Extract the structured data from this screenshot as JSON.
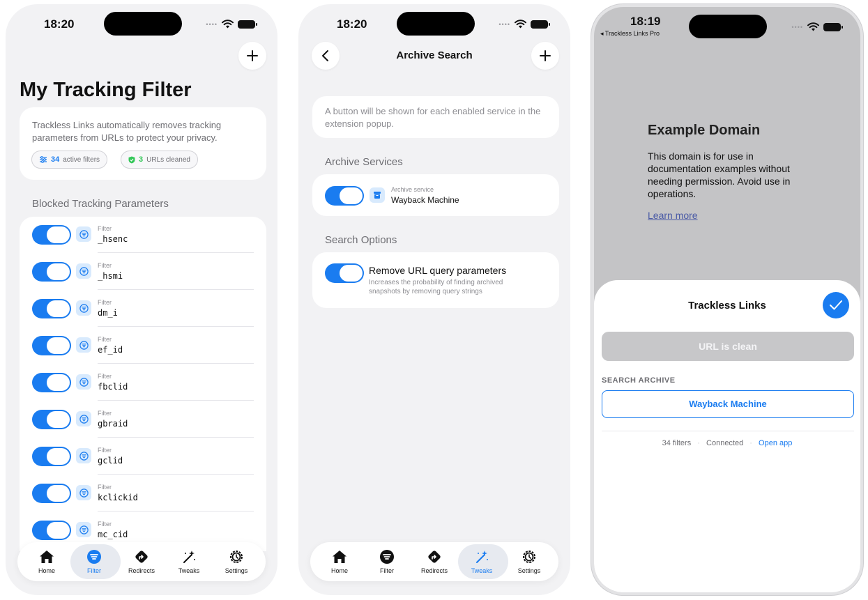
{
  "colors": {
    "accent": "#1a7cf0",
    "success": "#34c759"
  },
  "phone1": {
    "time": "18:20",
    "page_title": "My Tracking Filter",
    "intro": "Trackless Links automatically removes tracking parameters from URLs to protect your privacy.",
    "chips": [
      {
        "value": "34",
        "label": "active filters",
        "icon": "sliders-icon"
      },
      {
        "value": "3",
        "label": "URLs cleaned",
        "icon": "shield-check-icon"
      }
    ],
    "section_title": "Blocked Tracking Parameters",
    "row_label": "Filter",
    "filters": [
      "_hsenc",
      "_hsmi",
      "dm_i",
      "ef_id",
      "fbclid",
      "gbraid",
      "gclid",
      "kclickid",
      "mc_cid"
    ],
    "active_tab": "Filter"
  },
  "phone2": {
    "time": "18:20",
    "nav_title": "Archive Search",
    "info": "A button will be shown for each enabled service in the extension popup.",
    "archive_section": "Archive Services",
    "service_sub": "Archive service",
    "service_name": "Wayback Machine",
    "search_section": "Search Options",
    "option_title": "Remove URL query parameters",
    "option_desc": "Increases the probability of finding archived snapshots by removing query strings",
    "active_tab": "Tweaks"
  },
  "tabs": [
    {
      "label": "Home",
      "icon": "home-icon"
    },
    {
      "label": "Filter",
      "icon": "filter-icon"
    },
    {
      "label": "Redirects",
      "icon": "redirect-icon"
    },
    {
      "label": "Tweaks",
      "icon": "magic-wand-icon"
    },
    {
      "label": "Settings",
      "icon": "gear-icon"
    }
  ],
  "phone3": {
    "time": "18:19",
    "back_app": "◂ Trackless Links Pro",
    "web_title": "Example Domain",
    "web_body": "This domain is for use in documentation examples without needing permission. Avoid use in operations.",
    "web_link": "Learn more",
    "sheet_title": "Trackless Links",
    "clean_status": "URL is clean",
    "archive_heading": "SEARCH ARCHIVE",
    "archive_button": "Wayback Machine",
    "footer_filters": "34 filters",
    "footer_status": "Connected",
    "footer_link": "Open app"
  }
}
